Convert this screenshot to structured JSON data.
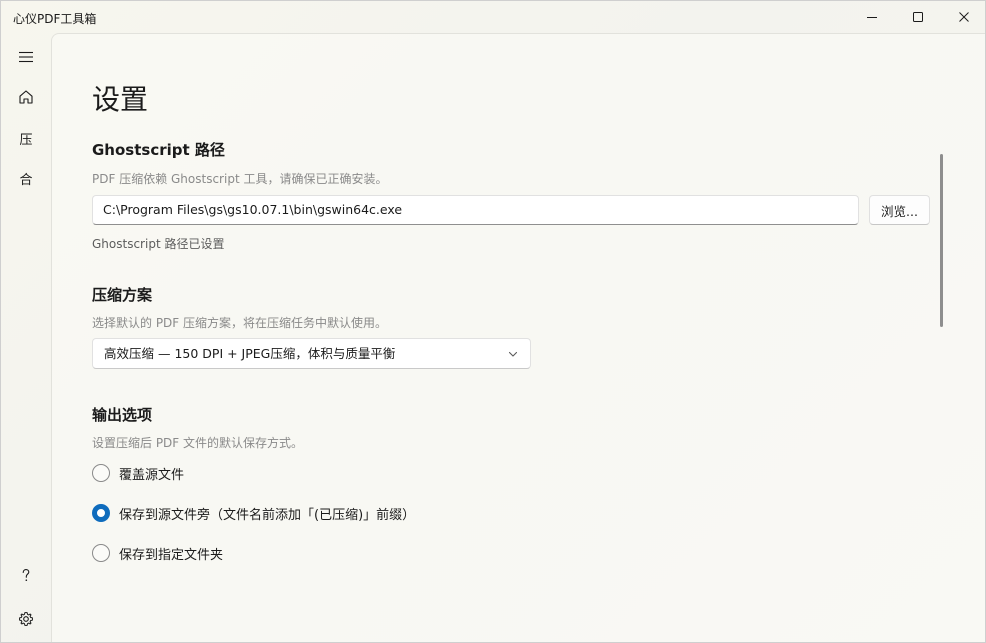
{
  "app": {
    "title": "心仪PDF工具箱"
  },
  "nav": {
    "compress_label": "压",
    "merge_label": "合"
  },
  "page": {
    "title": "设置"
  },
  "ghostscript": {
    "title": "Ghostscript 路径",
    "description": "PDF 压缩依赖 Ghostscript 工具，请确保已正确安装。",
    "path_value": "C:\\Program Files\\gs\\gs10.07.1\\bin\\gswin64c.exe",
    "browse_label": "浏览...",
    "status": "Ghostscript 路径已设置"
  },
  "compression": {
    "title": "压缩方案",
    "description": "选择默认的 PDF 压缩方案，将在压缩任务中默认使用。",
    "selected": "高效压缩 — 150 DPI + JPEG压缩，体积与质量平衡"
  },
  "output": {
    "title": "输出选项",
    "description": "设置压缩后 PDF 文件的默认保存方式。",
    "options": [
      {
        "label": "覆盖源文件",
        "checked": false
      },
      {
        "label": "保存到源文件旁（文件名前添加「(已压缩)」前缀）",
        "checked": true
      },
      {
        "label": "保存到指定文件夹",
        "checked": false
      }
    ]
  },
  "colors": {
    "accent": "#0f6cbd",
    "text": "#1b1b1b",
    "muted": "#8a8a8a"
  }
}
